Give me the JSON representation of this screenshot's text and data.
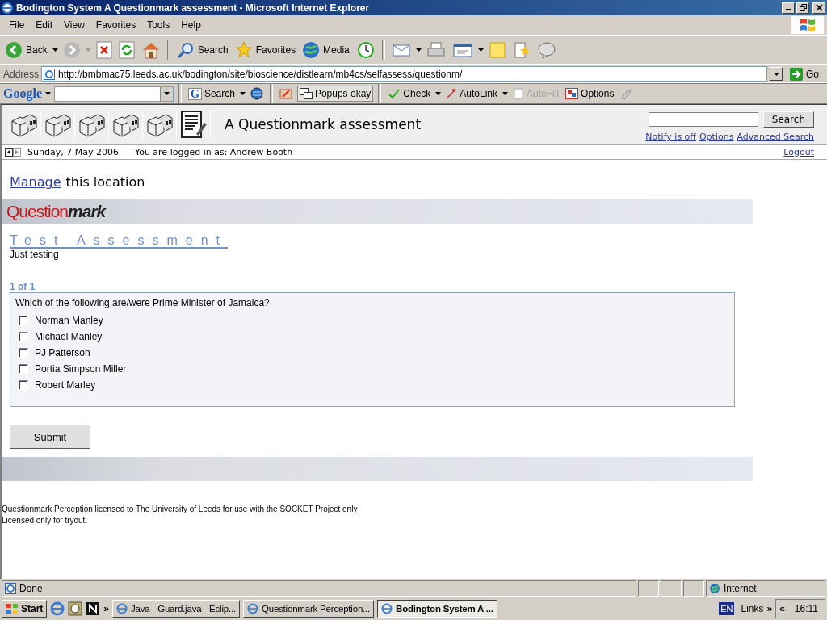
{
  "window": {
    "title": "Bodington System A Questionmark assessment - Microsoft Internet Explorer"
  },
  "menu": [
    "File",
    "Edit",
    "View",
    "Favorites",
    "Tools",
    "Help"
  ],
  "toolbar": {
    "back": "Back",
    "search": "Search",
    "favorites": "Favorites",
    "media": "Media"
  },
  "address": {
    "label": "Address",
    "value": "http://bmbmac75.leeds.ac.uk/bodington/site/bioscience/distlearn/mb4cs/selfassess/questionm/",
    "go": "Go"
  },
  "google_bar": {
    "logo": "Google",
    "search_letter": "G",
    "search": "Search",
    "popups": "Popups okay",
    "check": "Check",
    "autolink": "AutoLink",
    "autofill": "AutoFill",
    "autofill_disabled": true,
    "options": "Options"
  },
  "site_header": {
    "title": "A Questionmark assessment",
    "search_button": "Search",
    "links": [
      "Notify is off",
      "Options",
      "Advanced Search"
    ]
  },
  "info_bar": {
    "date": "Sunday, 7 May 2006",
    "user": "You are logged in as: Andrew Booth",
    "logout": "Logout"
  },
  "manage": {
    "link": "Manage",
    "text": "this location"
  },
  "logo": {
    "first": "Question",
    "second": "mark"
  },
  "assessment": {
    "title": "Test Assessment",
    "description": "Just testing",
    "progress": "1 of 1",
    "question": "Which of the following are/were Prime Minister of Jamaica?",
    "options": [
      {
        "label": "Norman Manley",
        "checked": false
      },
      {
        "label": "Michael Manley",
        "checked": false
      },
      {
        "label": "PJ Patterson",
        "checked": false
      },
      {
        "label": "Portia Simpson Miller",
        "checked": false
      },
      {
        "label": "Robert Marley",
        "checked": false
      }
    ],
    "submit": "Submit"
  },
  "license": [
    "Questionmark Perception licensed to The University of Leeds for use with the SOCKET Project only",
    "Licensed only for tryout."
  ],
  "status_bar": {
    "status": "Done",
    "zone": "Internet"
  },
  "taskbar": {
    "start": "Start",
    "more": "»",
    "tasks": [
      {
        "label": "Java - Guard.java - Eclip...",
        "selected": false
      },
      {
        "label": "Questionmark Perception...",
        "selected": false
      },
      {
        "label": "Bodington System A ...",
        "selected": true
      }
    ],
    "language": "EN",
    "links": "Links",
    "links_more": "»",
    "tray_toggle": "«",
    "clock": "16:11"
  }
}
